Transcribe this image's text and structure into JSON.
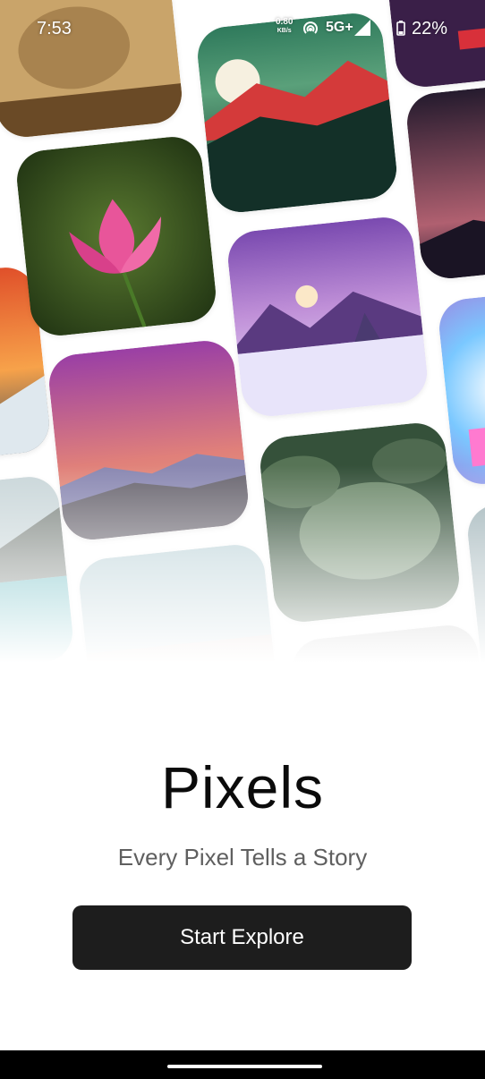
{
  "status_bar": {
    "time": "7:53",
    "net_speed": "0.80",
    "net_speed_unit": "KB/s",
    "network": "5G+",
    "battery": "22%"
  },
  "collage": {
    "tiles": [
      {
        "subject": "lion-cub",
        "colors": [
          "#c9a46a",
          "#7a5a30"
        ]
      },
      {
        "subject": "red-mountains-moon",
        "colors": [
          "#3d8a6a",
          "#c83a3a"
        ]
      },
      {
        "subject": "night-sky-mountains",
        "colors": [
          "#2a2030",
          "#b06060"
        ]
      },
      {
        "subject": "pink-lotus",
        "colors": [
          "#2f4a22",
          "#e0508f"
        ]
      },
      {
        "subject": "purple-snow-landscape",
        "colors": [
          "#8a5ab0",
          "#f0e8ff"
        ]
      },
      {
        "subject": "colorful-fantasy",
        "colors": [
          "#7ab8ff",
          "#ff7ad0"
        ]
      },
      {
        "subject": "orange-sunset-peak",
        "colors": [
          "#f08030",
          "#3b4a5a"
        ]
      },
      {
        "subject": "purple-gradient-mountains",
        "colors": [
          "#9a4aa0",
          "#e0886a"
        ]
      },
      {
        "subject": "monstera-leaves",
        "colors": [
          "#3a5a3a",
          "#6b8a6a"
        ]
      },
      {
        "subject": "alpine-lake",
        "colors": [
          "#7a8a8a",
          "#4aa8b0"
        ]
      },
      {
        "subject": "misty-landscape",
        "colors": [
          "#b8cad4",
          "#8aa0a8"
        ]
      }
    ]
  },
  "app": {
    "title": "Pixels",
    "subtitle": "Every Pixel Tells a Story",
    "cta_label": "Start Explore"
  }
}
